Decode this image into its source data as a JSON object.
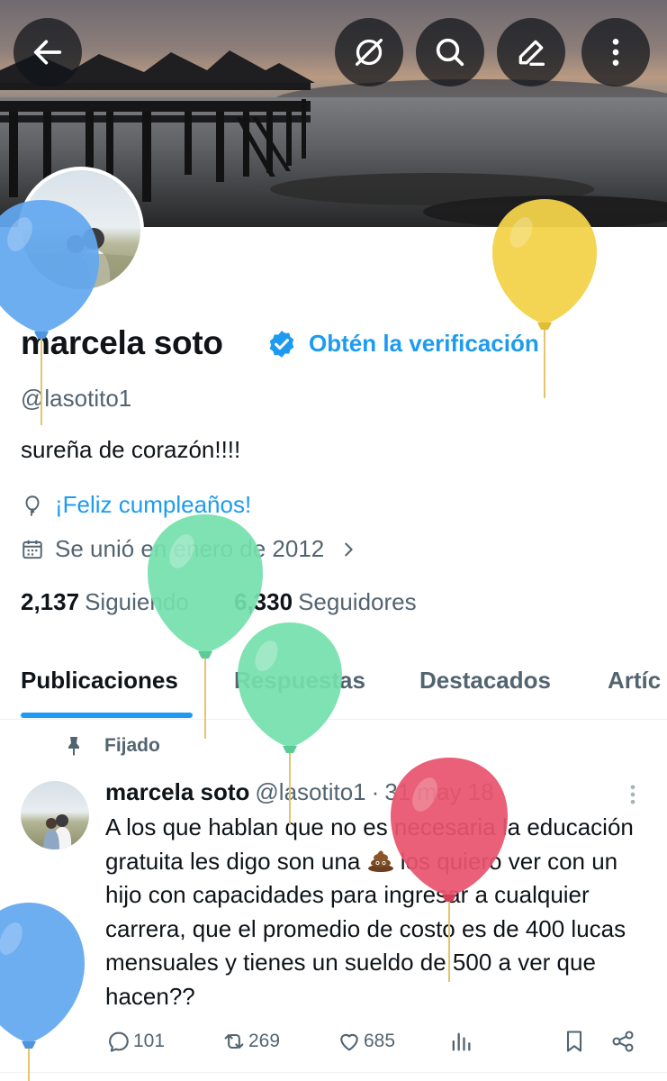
{
  "header": {
    "back_icon": "arrow-left-icon",
    "actions": [
      "mute-icon",
      "search-icon",
      "edit-icon",
      "more-vertical-icon"
    ]
  },
  "profile": {
    "name": "marcela soto",
    "verify_cta": "Obtén la verificación",
    "handle": "@lasotito1",
    "bio": "sureña de corazón!!!!",
    "birthday": "¡Feliz cumpleaños!",
    "joined": "Se unió en enero de 2012",
    "following_count": "2,137",
    "following_label": "Siguiendo",
    "followers_count": "6,330",
    "followers_label": "Seguidores"
  },
  "tabs": [
    {
      "label": "Publicaciones",
      "active": true
    },
    {
      "label": "Respuestas",
      "active": false
    },
    {
      "label": "Destacados",
      "active": false
    },
    {
      "label": "Artíc",
      "active": false
    }
  ],
  "post": {
    "pinned_label": "Fijado",
    "author": "marcela soto",
    "handle": "@lasotito1",
    "date": "31 may 18",
    "text_before": "A los que hablan que no es necesaria la educación gratuita les digo son una",
    "emoji": "pile-of-poo",
    "text_after": "los quiero ver con un hijo con capacidades para ingresar a cualquier carrera, que el promedio de costo es de 400 lucas mensuales y tienes un sueldo de 500 a ver que hacen??",
    "replies": "101",
    "reposts": "269",
    "likes": "685"
  },
  "colors": {
    "accent": "#1d9bf0",
    "secondary_text": "#536471",
    "balloon_blue": "#62a8f0",
    "balloon_yellow": "#f2d24a",
    "balloon_green": "#74e0ad",
    "balloon_red": "#e8546e"
  }
}
